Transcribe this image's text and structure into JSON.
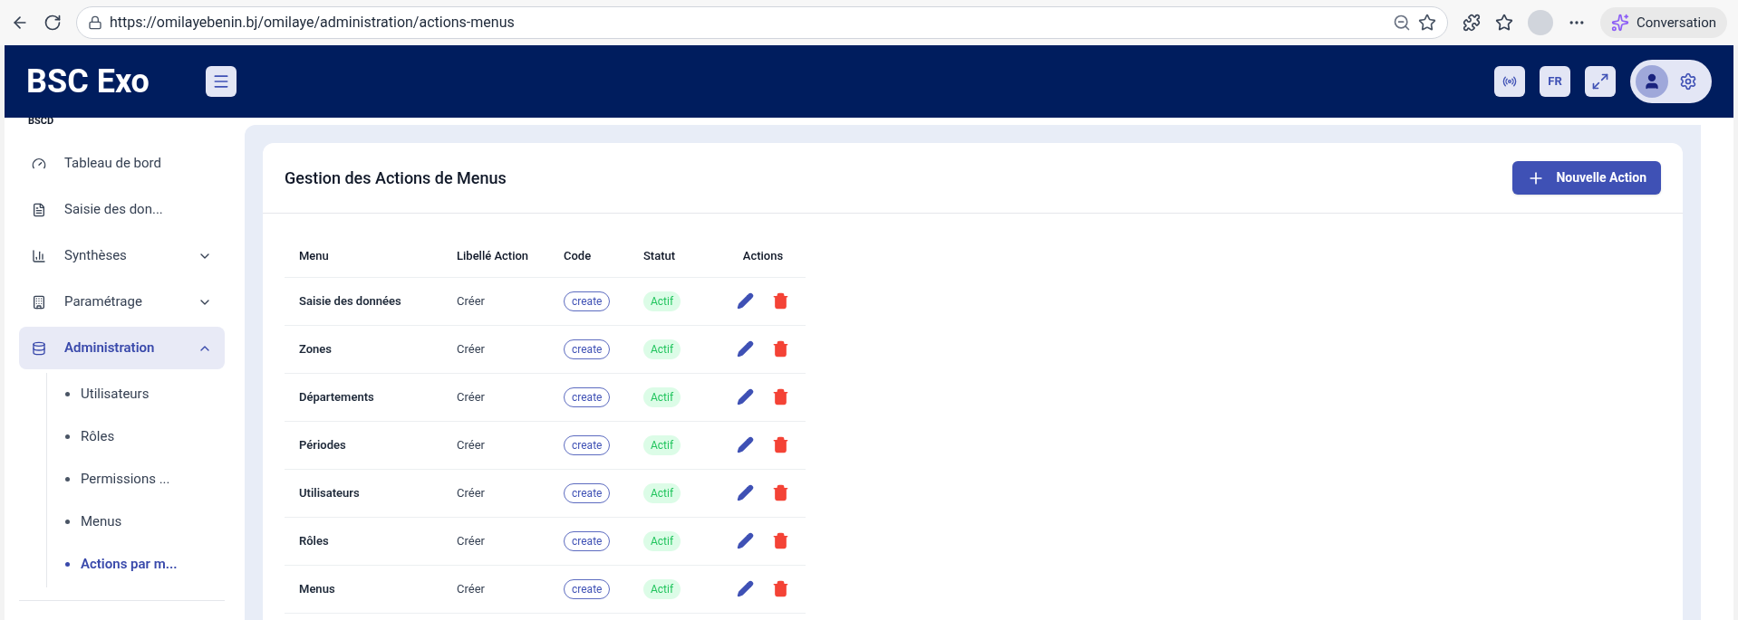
{
  "browser": {
    "url": "https://omilayebenin.bj/omilaye/administration/actions-menus",
    "copilot_label": "Conversation"
  },
  "header": {
    "brand": "BSC Exo",
    "language": "FR"
  },
  "sidebar": {
    "caption": "BSCD",
    "items": [
      {
        "label": "Tableau de bord",
        "selected": false
      },
      {
        "label": "Saisie des don...",
        "selected": false
      },
      {
        "label": "Synthèses",
        "selected": false,
        "expanded": false
      },
      {
        "label": "Paramétrage",
        "selected": false,
        "expanded": false
      },
      {
        "label": "Administration",
        "selected": true,
        "expanded": true,
        "children": [
          {
            "label": "Utilisateurs",
            "selected": false
          },
          {
            "label": "Rôles",
            "selected": false
          },
          {
            "label": "Permissions ...",
            "selected": false
          },
          {
            "label": "Menus",
            "selected": false
          },
          {
            "label": "Actions par m...",
            "selected": true
          }
        ]
      }
    ]
  },
  "page": {
    "title": "Gestion des Actions de Menus",
    "new_button": "Nouvelle Action"
  },
  "table": {
    "columns": [
      "Menu",
      "Libellé Action",
      "Code",
      "Statut",
      "Actions"
    ],
    "rows": [
      {
        "menu": "Saisie des données",
        "label": "Créer",
        "code": "create",
        "status": "Actif"
      },
      {
        "menu": "Zones",
        "label": "Créer",
        "code": "create",
        "status": "Actif"
      },
      {
        "menu": "Départements",
        "label": "Créer",
        "code": "create",
        "status": "Actif"
      },
      {
        "menu": "Périodes",
        "label": "Créer",
        "code": "create",
        "status": "Actif"
      },
      {
        "menu": "Utilisateurs",
        "label": "Créer",
        "code": "create",
        "status": "Actif"
      },
      {
        "menu": "Rôles",
        "label": "Créer",
        "code": "create",
        "status": "Actif"
      },
      {
        "menu": "Menus",
        "label": "Créer",
        "code": "create",
        "status": "Actif"
      }
    ]
  }
}
